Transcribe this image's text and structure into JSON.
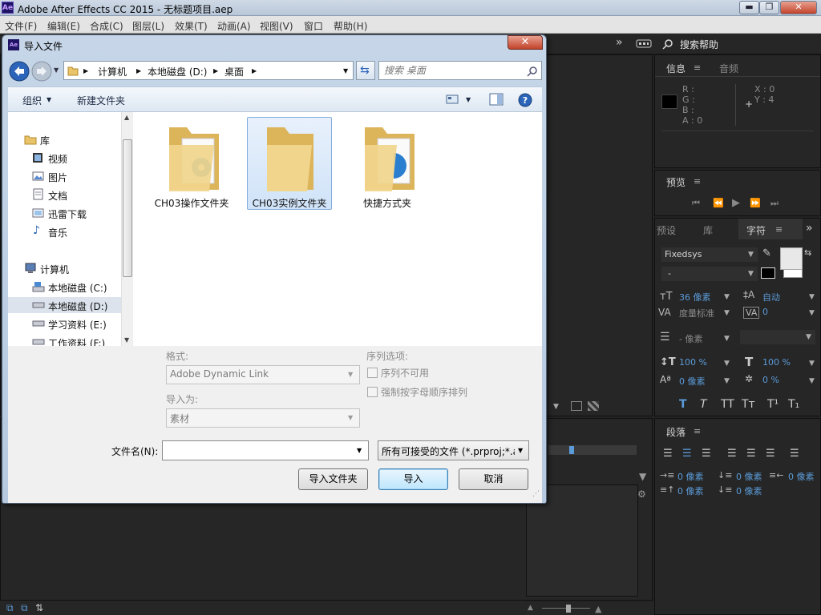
{
  "app": {
    "title": "Adobe After Effects CC 2015 - 无标题项目.aep",
    "logo_text": "Ae",
    "menus": [
      "文件(F)",
      "编辑(E)",
      "合成(C)",
      "图层(L)",
      "效果(T)",
      "动画(A)",
      "视图(V)",
      "窗口",
      "帮助(H)"
    ],
    "search_help": "搜索帮助"
  },
  "info_panel": {
    "tabs": [
      "信息",
      "音频"
    ],
    "r": "R :",
    "g": "G :",
    "b": "B :",
    "a": "A : 0",
    "x": "X : 0",
    "y": "Y : 4"
  },
  "preview_panel": {
    "title": "预览"
  },
  "character_panel": {
    "tabs": [
      "预设",
      "库",
      "字符"
    ],
    "font": "Fixedsys",
    "style": "-",
    "font_size": "36 像素",
    "leading": "自动",
    "kerning": "度量标准",
    "tracking": "0",
    "stroke_width": "- 像素",
    "vert_scale": "100 %",
    "horiz_scale": "100 %",
    "baseline_shift": "0 像素",
    "tsume": "0 %",
    "styles": [
      "T",
      "T",
      "TT",
      "Tт",
      "T¹",
      "T₁"
    ]
  },
  "paragraph_panel": {
    "title": "段落",
    "indent_left": "0 像素",
    "indent_first": "0 像素",
    "indent_right": "0 像素",
    "space_before": "0 像素",
    "space_after": "0 像素"
  },
  "dialog": {
    "title": "导入文件",
    "breadcrumb": [
      "计算机",
      "本地磁盘 (D:)",
      "桌面"
    ],
    "search_placeholder": "搜索 桌面",
    "organize": "组织",
    "new_folder": "新建文件夹",
    "nav": {
      "libraries": "库",
      "items": [
        "视频",
        "图片",
        "文档",
        "迅雷下载",
        "音乐"
      ],
      "computer": "计算机",
      "drives": [
        "本地磁盘 (C:)",
        "本地磁盘 (D:)",
        "学习资料 (E:)",
        "工作资料 (F:)"
      ]
    },
    "files": [
      "CH03操作文件夹",
      "CH03实例文件夹",
      "快捷方式夹"
    ],
    "format_label": "格式:",
    "format_value": "Adobe Dynamic Link",
    "import_as_label": "导入为:",
    "import_as_value": "素材",
    "sequence_label": "序列选项:",
    "sequence_unavailable": "序列不可用",
    "force_alpha": "强制按字母顺序排列",
    "filename_label": "文件名(N):",
    "filename_value": "",
    "filetype_value": "所有可接受的文件 (*.prproj;*.a",
    "btn_import_folder": "导入文件夹",
    "btn_import": "导入",
    "btn_cancel": "取消"
  },
  "colors": {
    "accent": "#5b9bd8",
    "panel_bg": "#262626",
    "dialog_frame": "#b6c9df"
  }
}
